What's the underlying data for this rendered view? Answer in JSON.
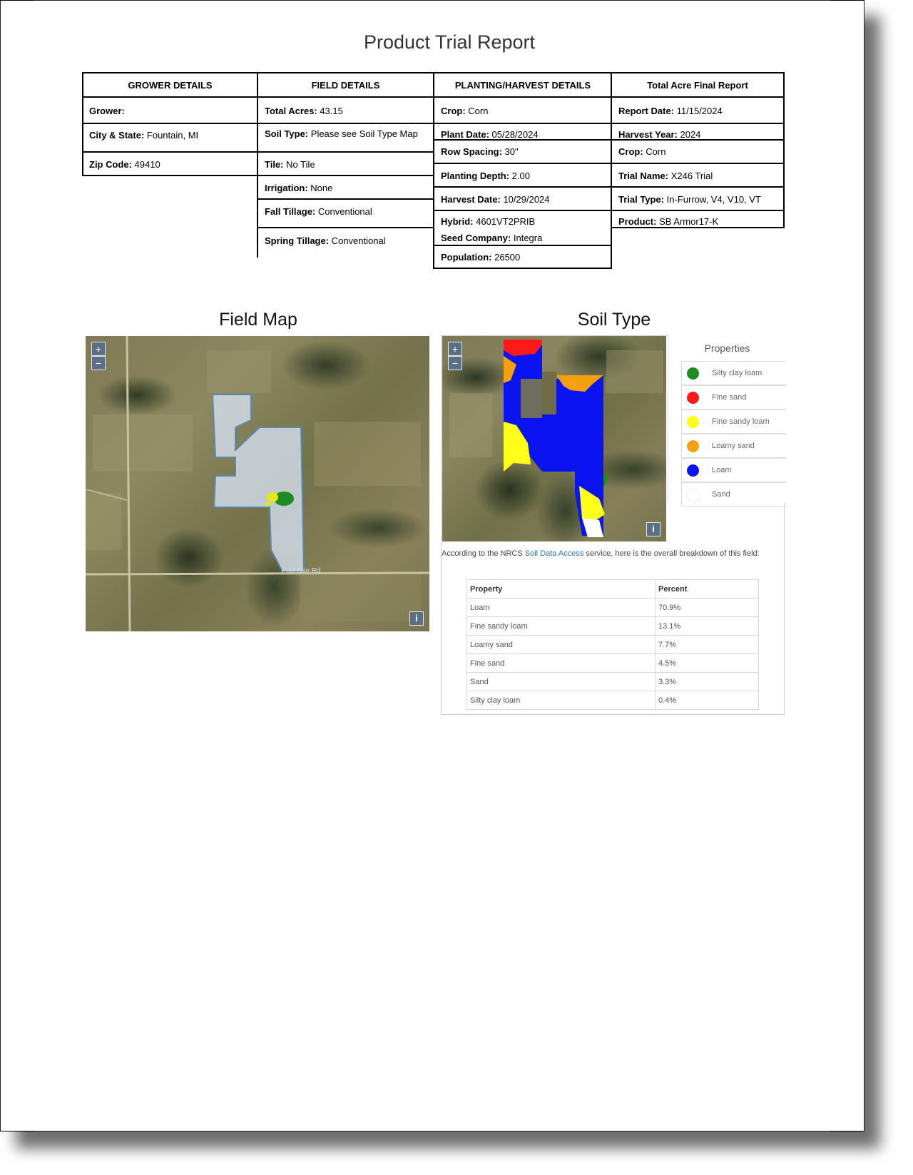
{
  "document": {
    "title": "Product Trial Report"
  },
  "grower": {
    "header": "GROWER DETAILS",
    "fields": [
      {
        "label": "Grower:",
        "value": ""
      },
      {
        "label": "City & State:",
        "value": " Fountain, MI"
      },
      {
        "label": "Zip Code:",
        "value": " 49410"
      }
    ]
  },
  "field": {
    "header": "FIELD DETAILS",
    "fields": [
      {
        "label": "Total Acres:",
        "value": " 43.15"
      },
      {
        "label": "Soil Type:",
        "value": " Please see Soil Type Map"
      },
      {
        "label": "Tile:",
        "value": " No Tile"
      },
      {
        "label": "Irrigation:",
        "value": " None"
      },
      {
        "label": "Fall Tillage:",
        "value": " Conventional"
      },
      {
        "label": "Spring Tillage:",
        "value": " Conventional"
      }
    ]
  },
  "planting": {
    "header": "PLANTING/HARVEST DETAILS",
    "fields": [
      {
        "label": "Crop:",
        "value": " Corn"
      },
      {
        "label": "Plant Date:",
        "value": " 05/28/2024"
      },
      {
        "label": "Row Spacing:",
        "value": " 30\""
      },
      {
        "label": "Planting Depth:",
        "value": " 2.00"
      },
      {
        "label": "Harvest Date:",
        "value": " 10/29/2024"
      },
      {
        "label": "Hybrid:",
        "value": " 4601VT2PRIB"
      },
      {
        "label": "Seed Company:",
        "value": " Integra"
      },
      {
        "label": "Population:",
        "value": " 26500"
      }
    ]
  },
  "report": {
    "header": "Total Acre Final Report",
    "fields": [
      {
        "label": "Report Date:",
        "value": " 11/15/2024"
      },
      {
        "label": "Harvest Year:",
        "value": " 2024"
      },
      {
        "label": "Crop:",
        "value": " Corn"
      },
      {
        "label": "Trial Name:",
        "value": " X246 Trial"
      },
      {
        "label": "Trial Type:",
        "value": " In-Furrow, V4, V10, VT"
      },
      {
        "label": "Product:",
        "value": " SB Armor17-K"
      }
    ]
  },
  "field_map": {
    "title": "Field Map",
    "zoom_in": "+",
    "zoom_out": "−",
    "info": "i",
    "road_label": "Fountain Rd"
  },
  "soil_type": {
    "title": "Soil Type",
    "zoom_in": "+",
    "zoom_out": "−",
    "info": "i",
    "legend_title": "Properties",
    "legend": [
      {
        "label": "Silty clay loam",
        "color": "#1f8a1f"
      },
      {
        "label": "Fine sand",
        "color": "#ff1a1a"
      },
      {
        "label": "Fine sandy loam",
        "color": "#ffff1a"
      },
      {
        "label": "Loamy sand",
        "color": "#f5a00f"
      },
      {
        "label": "Loam",
        "color": "#0a14f0"
      },
      {
        "label": "Sand",
        "color": "#ffffff"
      }
    ],
    "note_prefix": "According to the NRCS ",
    "note_link": "Soil Data Access",
    "note_suffix": " service, here is the overall breakdown of this field:",
    "table_headers": [
      "Property",
      "Percent"
    ],
    "table_rows": [
      [
        "Loam",
        "70.9%"
      ],
      [
        "Fine sandy loam",
        "13.1%"
      ],
      [
        "Loamy sand",
        "7.7%"
      ],
      [
        "Fine sand",
        "4.5%"
      ],
      [
        "Sand",
        "3.3%"
      ],
      [
        "Silty clay loam",
        "0.4%"
      ]
    ]
  }
}
